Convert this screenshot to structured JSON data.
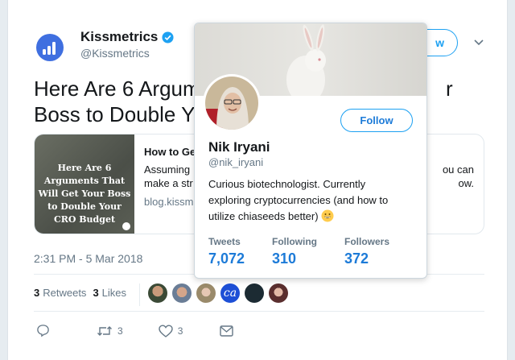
{
  "tweet": {
    "author_name": "Kissmetrics",
    "author_handle": "@Kissmetrics",
    "follow_label": "w",
    "headline": "Here Are 6 Argum                              r Boss to Double Y",
    "headline_line1": "Here Are 6 Argum",
    "headline_line1_end": "r",
    "headline_line2": "Boss to Double Y",
    "link_card": {
      "thumb_text": "Here Are 6 Arguments That Will Get Your Boss to Double Your CRO Budget",
      "title": "How to Ge",
      "desc_line1": "Assuming",
      "desc_line1_end": "ou can",
      "desc_line2": "make a str",
      "desc_line2_end": "ow.",
      "domain": "blog.kissm"
    },
    "timestamp": "2:31 PM - 5 Mar 2018",
    "retweets_count": "3",
    "retweets_label": "Retweets",
    "likes_count": "3",
    "likes_label": "Likes",
    "actions": {
      "retweet_count": "3",
      "like_count": "3"
    }
  },
  "popup": {
    "name": "Nik Iryani",
    "handle": "@nik_iryani",
    "follow_label": "Follow",
    "bio_line1": "Curious biotechnologist. Currently",
    "bio_line2": "exploring cryptocurrencies (and how to",
    "bio_line3": "utilize chiaseeds better)",
    "tweets_label": "Tweets",
    "tweets_value": "7,072",
    "following_label": "Following",
    "following_value": "310",
    "followers_label": "Followers",
    "followers_value": "372"
  },
  "colors": {
    "accent": "#1da1f2",
    "link": "#1d7bd8",
    "muted": "#657786",
    "logo": "#3f6fe0"
  },
  "icons": [
    "kissmetrics-logo-icon",
    "verified-badge-icon",
    "chevron-down-icon",
    "reply-icon",
    "retweet-icon",
    "like-icon",
    "direct-message-icon",
    "grinning-emoji-icon"
  ]
}
